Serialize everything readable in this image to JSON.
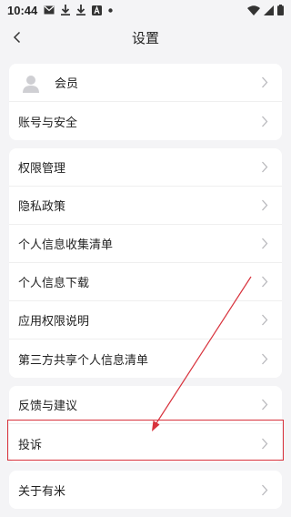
{
  "status_bar": {
    "time": "10:44"
  },
  "nav": {
    "title": "设置"
  },
  "groups": [
    {
      "rows": [
        {
          "label": "会员",
          "has_avatar": true
        },
        {
          "label": "账号与安全"
        }
      ]
    },
    {
      "rows": [
        {
          "label": "权限管理"
        },
        {
          "label": "隐私政策"
        },
        {
          "label": "个人信息收集清单"
        },
        {
          "label": "个人信息下载"
        },
        {
          "label": "应用权限说明"
        },
        {
          "label": "第三方共享个人信息清单"
        }
      ]
    },
    {
      "rows": [
        {
          "label": "反馈与建议"
        },
        {
          "label": "投诉"
        }
      ]
    },
    {
      "rows": [
        {
          "label": "关于有米"
        }
      ]
    }
  ],
  "annotation": {
    "highlight_color": "#d8323c",
    "highlighted_item": "投诉"
  }
}
